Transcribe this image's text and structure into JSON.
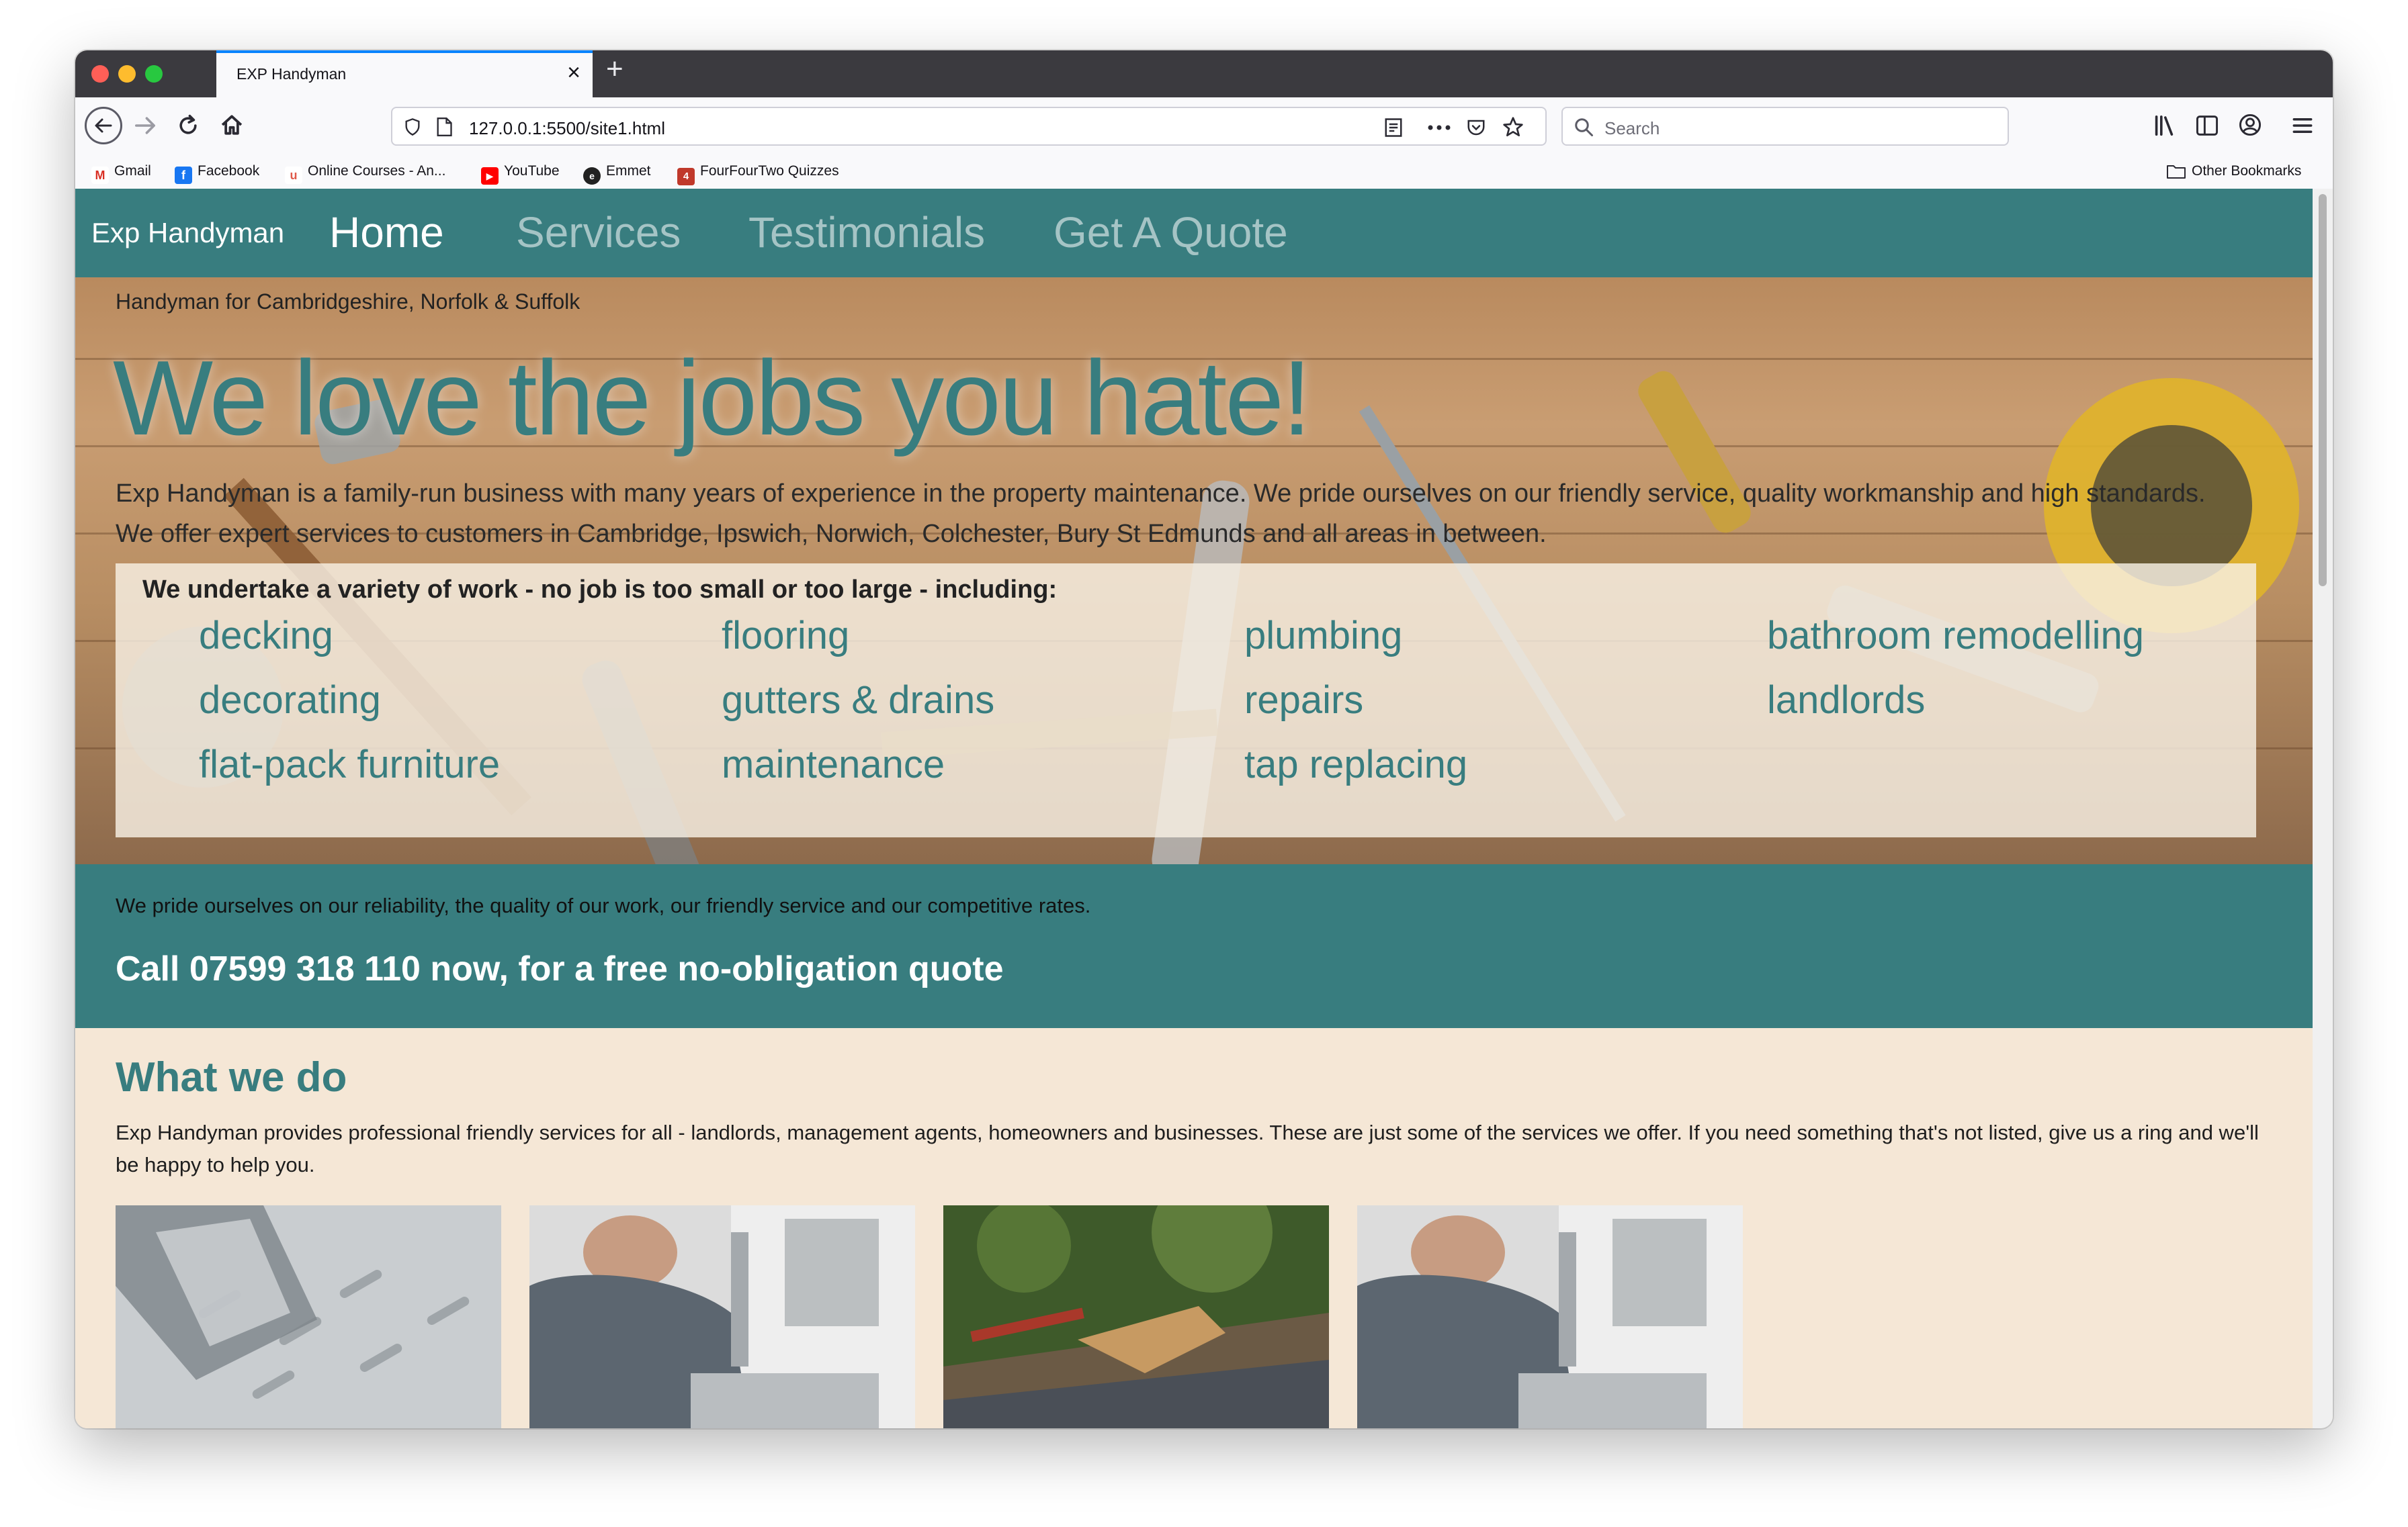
{
  "browser": {
    "tab_title": "EXP Handyman",
    "tab_close": "×",
    "new_tab": "+",
    "url": "127.0.0.1:5500/site1.html",
    "search_placeholder": "Search",
    "bookmarks": [
      {
        "label": "Gmail",
        "icon": "gmail-icon"
      },
      {
        "label": "Facebook",
        "icon": "facebook-icon"
      },
      {
        "label": "Online Courses - An...",
        "icon": "courses-icon"
      },
      {
        "label": "YouTube",
        "icon": "youtube-icon"
      },
      {
        "label": "Emmet",
        "icon": "emmet-icon"
      },
      {
        "label": "FourFourTwo Quizzes",
        "icon": "fourfourtwo-icon"
      }
    ],
    "other_bookmarks": "Other Bookmarks"
  },
  "site": {
    "brand": "Exp Handyman",
    "nav": [
      "Home",
      "Services",
      "Testimonials",
      "Get A Quote"
    ],
    "active_nav": "Home"
  },
  "hero": {
    "subtitle": "Handyman for Cambridgeshire, Norfolk & Suffolk",
    "title": "We love the jobs you hate!",
    "intro_1": "Exp Handyman is a family-run business with many years of experience in the property maintenance. We pride ourselves on our friendly service, quality workmanship and high standards.",
    "intro_2": "We offer expert services to customers in Cambridge, Ipswich, Norwich, Colchester, Bury St Edmunds and all areas in between.",
    "work_title": "We undertake a variety of work - no job is too small or too large - including:",
    "work_items": [
      "decking",
      "flooring",
      "plumbing",
      "bathroom remodelling",
      "decorating",
      "gutters & drains",
      "repairs",
      "landlords",
      "flat-pack furniture",
      "maintenance",
      "tap replacing"
    ]
  },
  "cta": {
    "line": "We pride ourselves on our reliability, the quality of our work, our friendly service and our competitive rates.",
    "call": "Call 07599 318 110 now, for a free no-obligation quote"
  },
  "what_we_do": {
    "title": "What we do",
    "text": "Exp Handyman provides professional friendly services for all - landlords, management agents, homeowners and businesses. These are just some of the services we offer. If you need something that's not listed, give us a ring and we'll be happy to help you."
  },
  "colors": {
    "brand_teal": "#387d7f",
    "page_background": "#f5e7d6"
  }
}
